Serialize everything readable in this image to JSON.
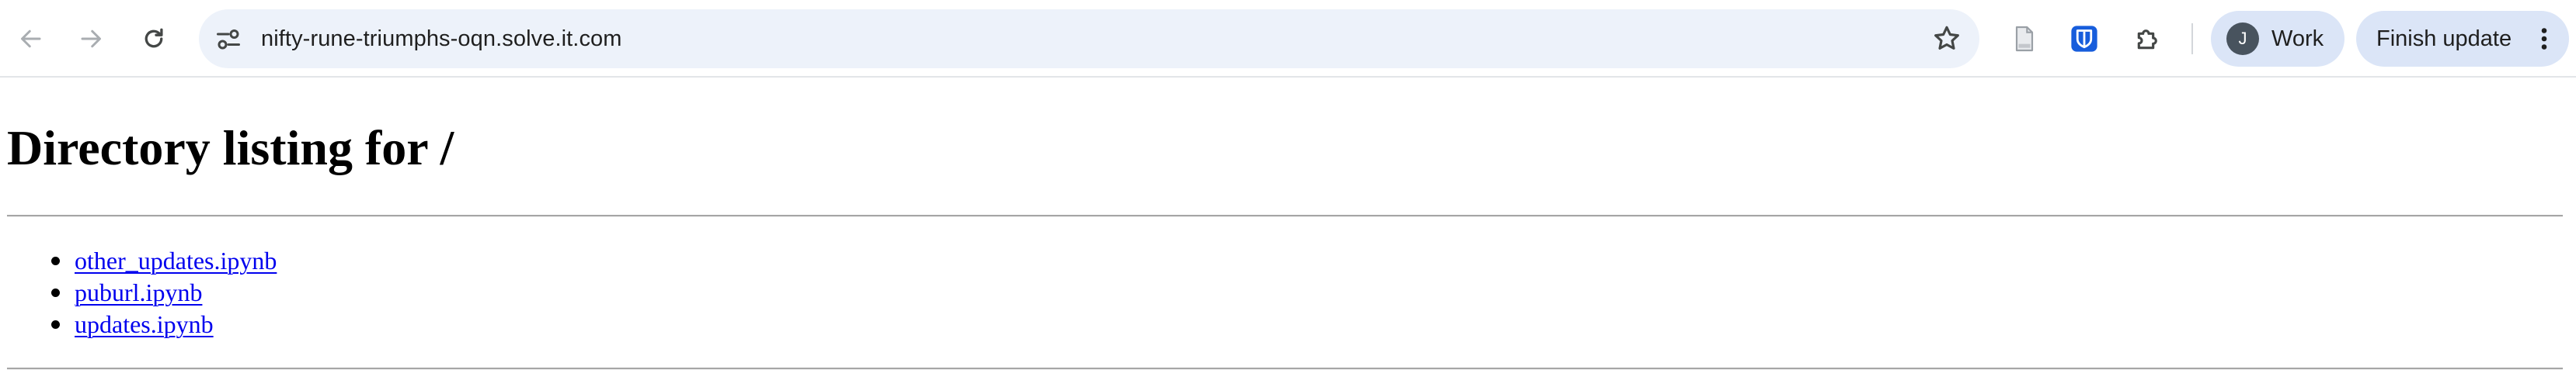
{
  "browser": {
    "address_bar": {
      "url": "nifty-rune-triumphs-oqn.solve.it.com"
    },
    "profile": {
      "avatar_initial": "J",
      "label": "Work"
    },
    "update_button": {
      "label": "Finish update"
    },
    "icons": {
      "back": "arrow-left-icon",
      "forward": "arrow-right-icon",
      "reload": "reload-icon",
      "site_info": "tune-icon",
      "bookmark": "star-outline-icon",
      "extension_1": "document-icon",
      "extension_2": "bitwarden-shield-icon",
      "extensions": "puzzle-icon",
      "menu": "kebab-menu-icon"
    },
    "colors": {
      "omnibox_bg": "#edf2fa",
      "chip_bg": "#dbe5f7",
      "bitwarden_blue": "#175ddc"
    }
  },
  "page": {
    "title": "Directory listing for /",
    "files": [
      {
        "name": "other_updates.ipynb"
      },
      {
        "name": "puburl.ipynb"
      },
      {
        "name": "updates.ipynb"
      }
    ],
    "link_color": "#0000ee"
  }
}
